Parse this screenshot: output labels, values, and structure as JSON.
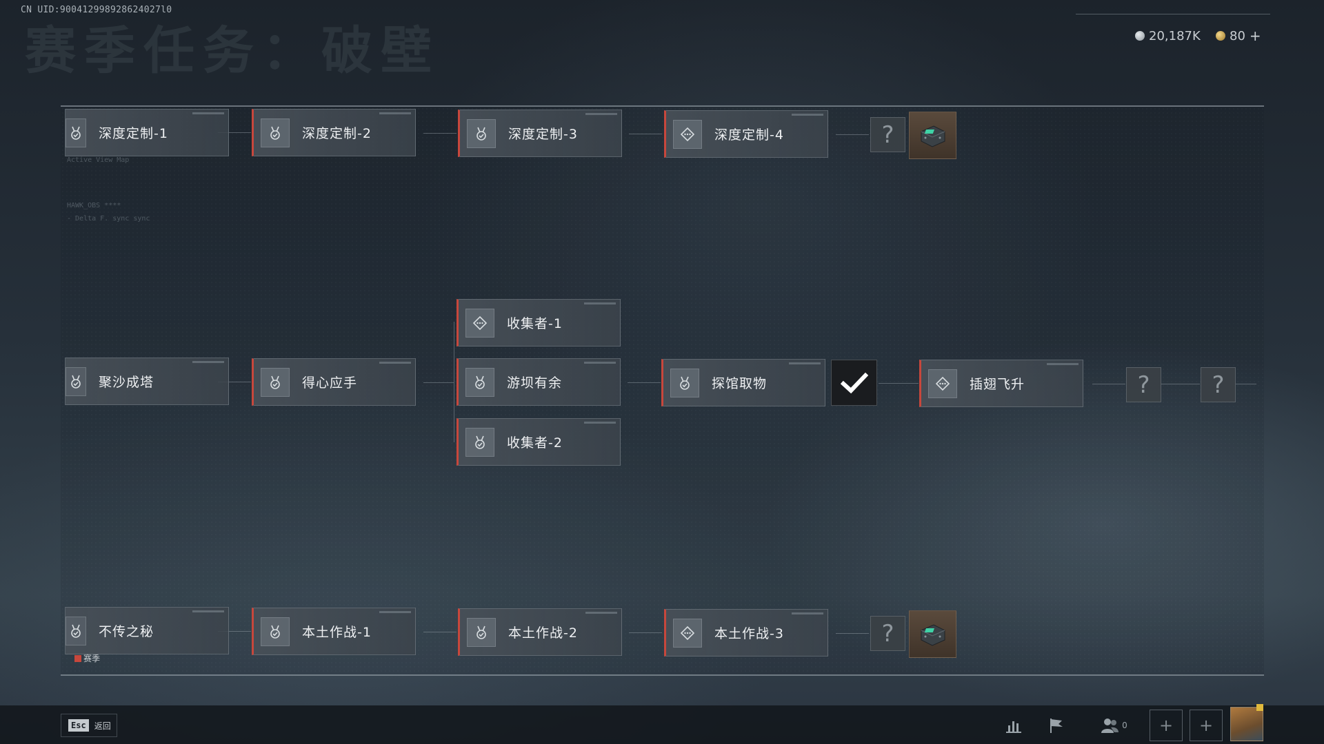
{
  "uid": "CN UID:900412998928624027l0",
  "page_title": "赛季任务：破壁",
  "currency": {
    "silver": "20,187K",
    "gold": "80",
    "gold_plus": "+"
  },
  "rows": {
    "top": {
      "cards": [
        {
          "label": "深度定制-1",
          "icon": "medal-check-icon"
        },
        {
          "label": "深度定制-2",
          "icon": "medal-check-icon"
        },
        {
          "label": "深度定制-3",
          "icon": "medal-check-icon"
        },
        {
          "label": "深度定制-4",
          "icon": "diamond-target-icon"
        }
      ],
      "unknown": "?"
    },
    "middle": {
      "cards": [
        {
          "label": "聚沙成塔",
          "icon": "medal-check-icon"
        },
        {
          "label": "得心应手",
          "icon": "medal-check-icon"
        },
        {
          "label": "收集者-1",
          "icon": "diamond-target-icon"
        },
        {
          "label": "游坝有余",
          "icon": "medal-check-icon"
        },
        {
          "label": "收集者-2",
          "icon": "medal-check-icon"
        },
        {
          "label": "探馆取物",
          "icon": "medal-check-icon"
        },
        {
          "label": "插翅飞升",
          "icon": "diamond-target-icon"
        }
      ],
      "unknown_1": "?",
      "unknown_2": "?"
    },
    "bottom": {
      "cards": [
        {
          "label": "不传之秘",
          "icon": "medal-check-icon"
        },
        {
          "label": "本土作战-1",
          "icon": "medal-check-icon"
        },
        {
          "label": "本土作战-2",
          "icon": "medal-check-icon"
        },
        {
          "label": "本土作战-3",
          "icon": "diamond-target-icon"
        }
      ],
      "unknown": "?"
    }
  },
  "legend": {
    "label": "赛季",
    "color": "#c8473c"
  },
  "deco_text": [
    "Active View Map",
    "HAWK_OBS ****",
    "- Delta F. sync sync"
  ],
  "footer": {
    "esc_key": "Esc",
    "esc_label": "返回",
    "friend_count": "0",
    "slot_plus": "+"
  },
  "colors": {
    "season_red": "#c8473c",
    "card_bg": "#484f57",
    "accent_gold": "#e0b93c"
  }
}
